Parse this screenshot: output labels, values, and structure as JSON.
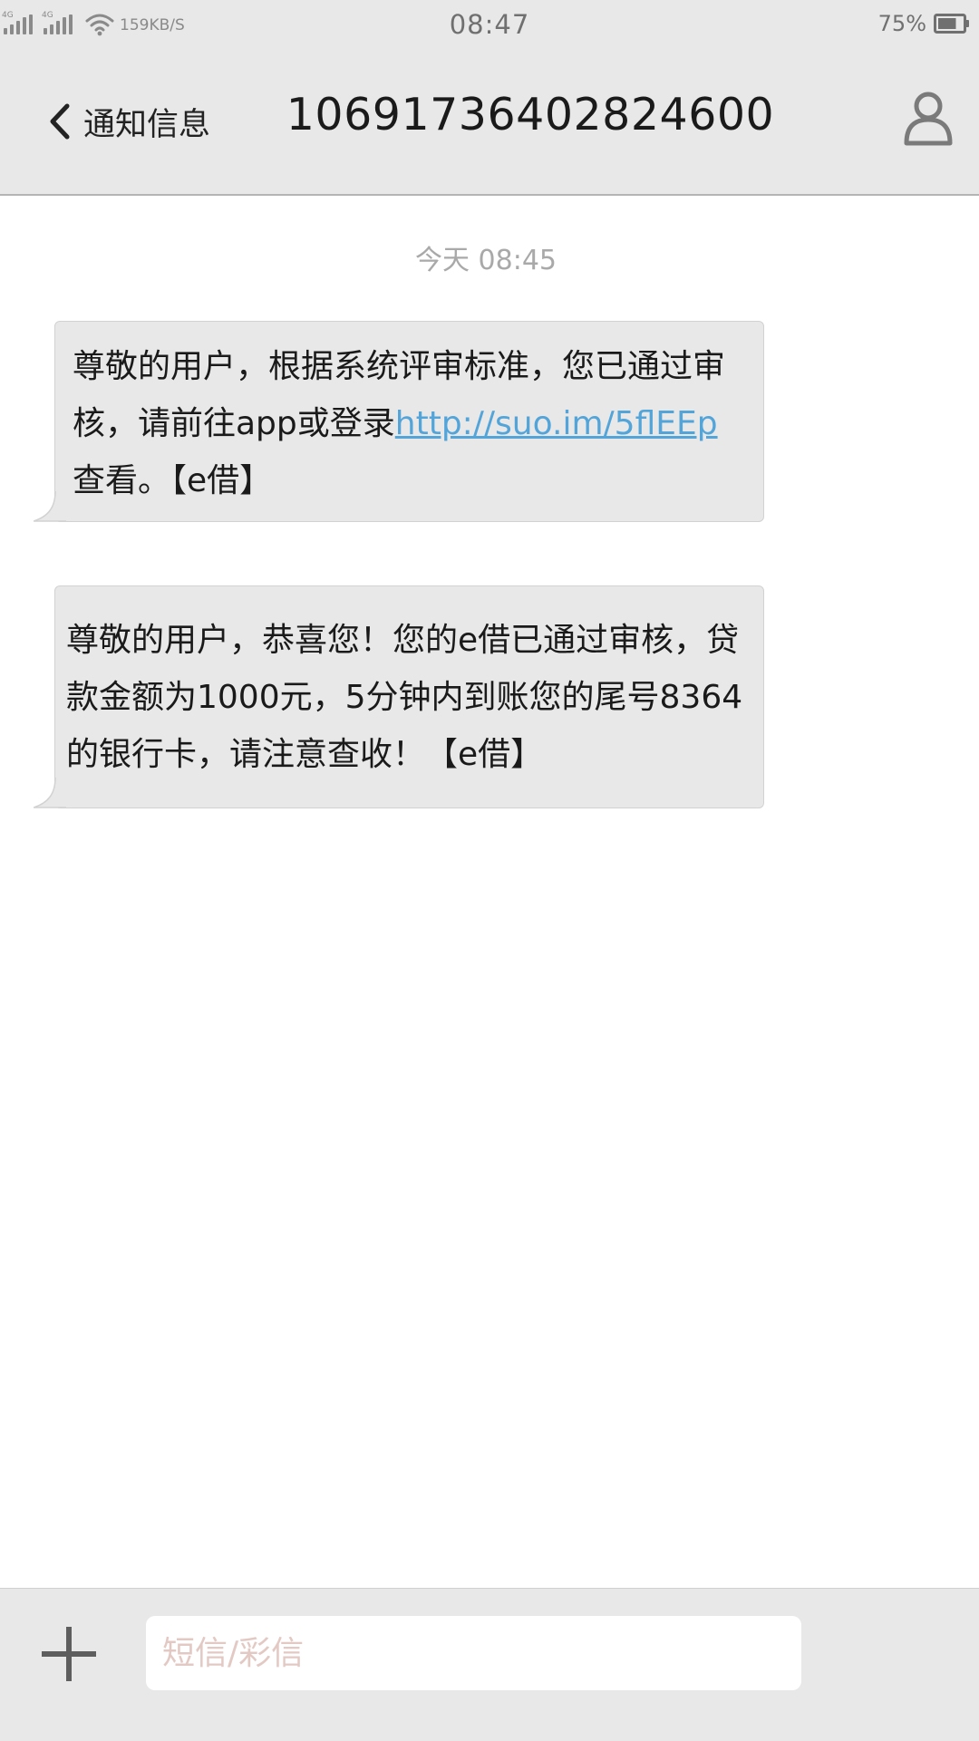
{
  "status_bar": {
    "sim1_network": "4G",
    "sim2_network": "4G",
    "net_speed": "159KB/S",
    "time": "08:47",
    "battery_percent": "75%",
    "battery_level": 0.75
  },
  "header": {
    "back_label": "通知信息",
    "contact_number": "10691736402824600"
  },
  "conversation": {
    "timestamp": "今天 08:45",
    "messages": [
      {
        "lines": [
          "尊敬的用户，根据系统评审标准，您已通过审",
          "核，请前往app或登录",
          "查看。【e借】"
        ],
        "link": "http://suo.im/5flEEp"
      },
      {
        "lines": [
          "尊敬的用户，恭喜您！您的e借已通过审核，贷",
          "款金额为1000元，5分钟内到账您的尾号8364",
          "的银行卡，请注意查收！【e借】"
        ]
      }
    ]
  },
  "compose": {
    "placeholder": "短信/彩信",
    "value": ""
  },
  "colors": {
    "bar_background": "#e8e8e8",
    "bubble_background": "#e8e8e8",
    "link": "#52a4d9",
    "timestamp": "#a9a9a9",
    "placeholder": "#e3c9c4"
  },
  "icons": [
    "signal-icon",
    "wifi-icon",
    "battery-icon",
    "back-chevron-icon",
    "contact-person-icon",
    "plus-icon"
  ]
}
